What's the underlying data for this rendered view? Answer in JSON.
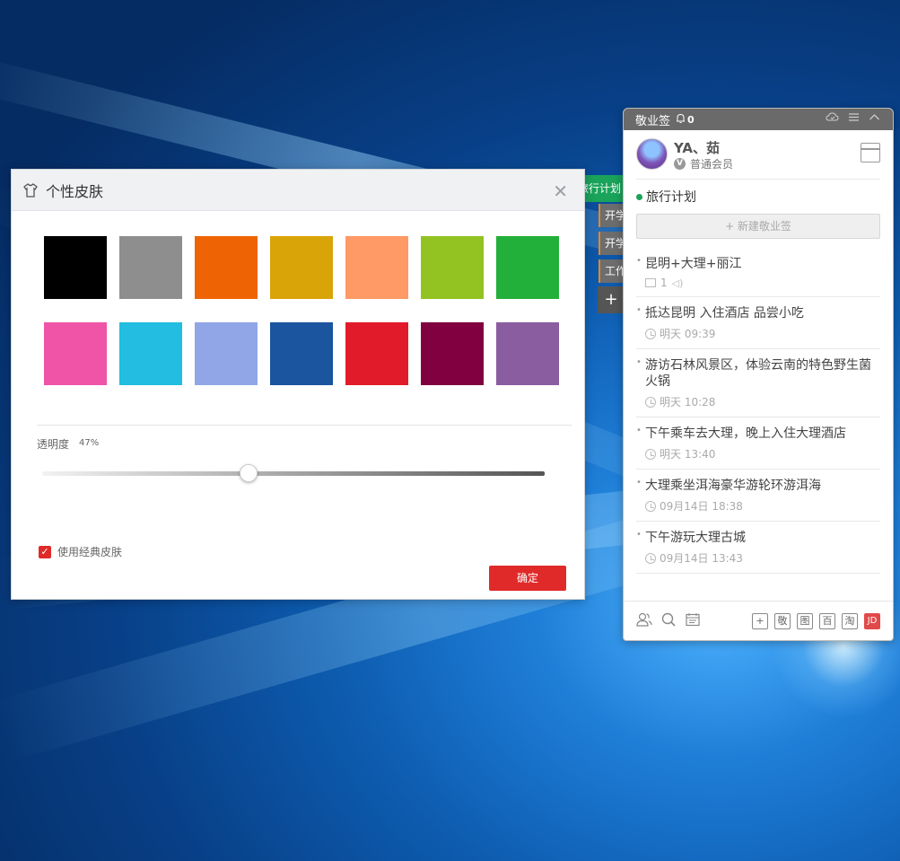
{
  "background_window": {
    "title": "旅行计划",
    "tabs": [
      "开学",
      "开学",
      "工作"
    ],
    "add_label": "+"
  },
  "skin_dialog": {
    "title": "个性皮肤",
    "close_label": "✕",
    "colors": [
      "#000000",
      "#8e8e8e",
      "#ee6405",
      "#d9a408",
      "#ff9966",
      "#92c322",
      "#22b03a",
      "#ef54a6",
      "#22bde0",
      "#90a6e6",
      "#1b549f",
      "#e21b2a",
      "#800040",
      "#8a5da0"
    ],
    "opacity_label": "透明度",
    "opacity_value": "47%",
    "opacity_fraction": 0.41,
    "classic_checked_mark": "✓",
    "classic_label": "使用经典皮肤",
    "ok_label": "确定"
  },
  "widget": {
    "app_name": "敬业签",
    "bell_icon": "🔔",
    "reminder_count": "0",
    "user_name": "YA、茹",
    "vip_badge": "V",
    "member_level": "普通会员",
    "category": "旅行计划",
    "new_note_label": "+ 新建敬业签",
    "notes": [
      {
        "text": "昆明+大理+丽江",
        "attachments": "1",
        "type": "media"
      },
      {
        "text": "抵达昆明  入住酒店  品尝小吃",
        "time": "明天 09:39",
        "type": "time"
      },
      {
        "text": "游访石林风景区，体验云南的特色野生菌火锅",
        "time": "明天 10:28",
        "type": "time"
      },
      {
        "text": "下午乘车去大理，晚上入住大理酒店",
        "time": "明天 13:40",
        "type": "time"
      },
      {
        "text": "大理乘坐洱海豪华游轮环游洱海",
        "time": "09月14日 18:38",
        "type": "time"
      },
      {
        "text": "下午游玩大理古城",
        "time": "09月14日 13:43",
        "type": "time"
      }
    ],
    "footer_buttons": [
      "+",
      "敬",
      "图",
      "百",
      "淘",
      "JD"
    ]
  }
}
